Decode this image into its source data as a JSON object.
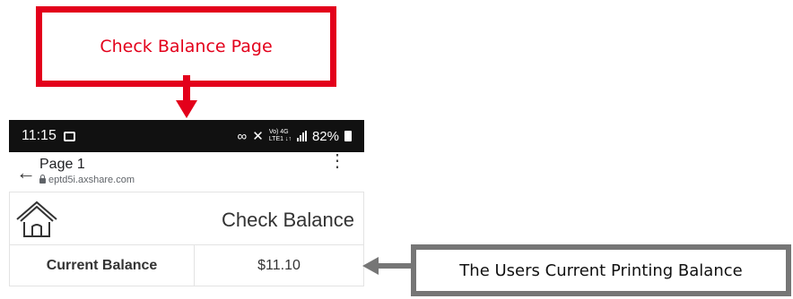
{
  "annotations": {
    "top_callout": "Check Balance Page",
    "right_callout": "The Users Current Printing Balance"
  },
  "status_bar": {
    "time": "11:15",
    "network_top": "Vo) 4G",
    "network_bottom": "LTE1 ↓↑",
    "battery": "82%",
    "icons": [
      "image-icon",
      "link-icon",
      "mute-icon",
      "signal-icon",
      "battery-icon"
    ]
  },
  "browser": {
    "page_title": "Page 1",
    "url": "eptd5i.axshare.com",
    "menu": "⋮",
    "back": "←"
  },
  "app": {
    "title": "Check Balance",
    "balance_label": "Current Balance",
    "balance_value": "$11.10"
  },
  "colors": {
    "callout_red": "#e3001b",
    "callout_gray": "#767676"
  }
}
